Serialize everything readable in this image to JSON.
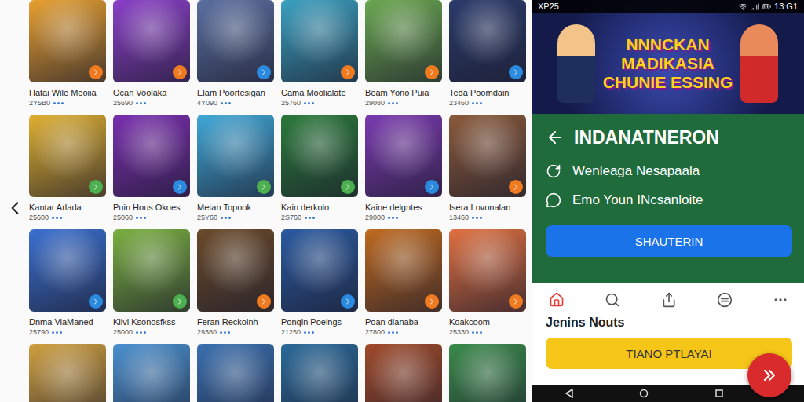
{
  "games": [
    {
      "title": "Hatai Wile Meoiia",
      "count": "2Y5B0",
      "color": "#e8a030",
      "badge": "#f07a20"
    },
    {
      "title": "Ocan Voolaka",
      "count": "25690",
      "color": "#8a3fc8",
      "badge": "#f07a20"
    },
    {
      "title": "Elam Poortesigan",
      "count": "4Y090",
      "color": "#5a6fa0",
      "badge": "#2a8ae0"
    },
    {
      "title": "Cama Moolialate",
      "count": "25760",
      "color": "#3aa0c0",
      "badge": "#f07a20"
    },
    {
      "title": "Beam Yono Puia",
      "count": "29080",
      "color": "#6aa84f",
      "badge": "#f07a20"
    },
    {
      "title": "Teda Poomdain",
      "count": "23460",
      "color": "#2a3a6a",
      "badge": "#2a8ae0"
    },
    {
      "title": "Kantar Arlada",
      "count": "25600",
      "color": "#e0b030",
      "badge": "#4caf50"
    },
    {
      "title": "Puin Hous Okoes",
      "count": "25060",
      "color": "#7a2fb0",
      "badge": "#2a8ae0"
    },
    {
      "title": "Metan Topook",
      "count": "25Y60",
      "color": "#40a8d8",
      "badge": "#4caf50"
    },
    {
      "title": "Kain derkolo",
      "count": "2S760",
      "color": "#2a7a3a",
      "badge": "#4caf50"
    },
    {
      "title": "Kaine delgntes",
      "count": "29000",
      "color": "#7a3ab0",
      "badge": "#2a8ae0"
    },
    {
      "title": "Isera Lovonalan",
      "count": "13460",
      "color": "#8a5a3a",
      "badge": "#f07a20"
    },
    {
      "title": "Dnma ViaManed",
      "count": "25790",
      "color": "#3a70d0",
      "badge": "#2a8ae0"
    },
    {
      "title": "Kilvl Ksonosfkss",
      "count": "25000",
      "color": "#7ab040",
      "badge": "#4caf50"
    },
    {
      "title": "Feran Reckoinh",
      "count": "29380",
      "color": "#6a4a2a",
      "badge": "#f07a20"
    },
    {
      "title": "Ponqin Poeings",
      "count": "21250",
      "color": "#2a5aa0",
      "badge": "#2a8ae0"
    },
    {
      "title": "Poan dianaba",
      "count": "27800",
      "color": "#c06a20",
      "badge": "#f07a20"
    },
    {
      "title": "Koakcoom",
      "count": "25330",
      "color": "#e07040",
      "badge": "#f07a20"
    }
  ],
  "partial_row": [
    {
      "color": "#d0a040"
    },
    {
      "color": "#4a90d0"
    },
    {
      "color": "#3a70b0"
    },
    {
      "color": "#2a6a9a"
    },
    {
      "color": "#a04a2a"
    },
    {
      "color": "#3a8a4a"
    }
  ],
  "phone": {
    "status_bar": {
      "left": "XP25",
      "time": "13:G1"
    },
    "banner": {
      "lines": [
        "NNNCKAN",
        "MADIKASIA",
        "CHUNIE ESSING"
      ]
    },
    "header": {
      "title": "INDANATNERON"
    },
    "options": [
      {
        "kind": "refresh",
        "label": "Wenleaga Nesapaala"
      },
      {
        "kind": "chat",
        "label": "Emo Youn INcsanloite"
      }
    ],
    "primary_button": "SHAUTERIN",
    "tabs": [
      {
        "kind": "home",
        "selected": true
      },
      {
        "kind": "search",
        "selected": false
      },
      {
        "kind": "share",
        "selected": false
      },
      {
        "kind": "compare",
        "selected": false
      },
      {
        "kind": "more",
        "selected": false
      }
    ],
    "section_title": "Jenins Nouts",
    "play_button": "TIANO PTLAYAI"
  }
}
